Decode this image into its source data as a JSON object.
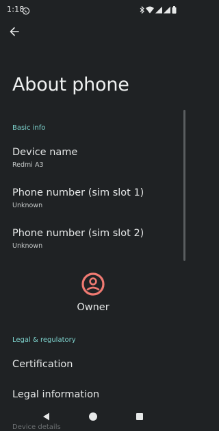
{
  "status_bar": {
    "time": "1:18",
    "notification_icon": "whatsapp-icon",
    "icons": [
      "bluetooth-icon",
      "wifi-icon",
      "signal-icon",
      "signal-icon",
      "battery-icon"
    ]
  },
  "header": {
    "back_icon": "arrow-left-icon",
    "title": "About phone"
  },
  "sections": {
    "basic_info": {
      "header": "Basic info",
      "items": [
        {
          "title": "Device name",
          "summary": "Redmi A3"
        },
        {
          "title": "Phone number (sim slot 1)",
          "summary": "Unknown"
        },
        {
          "title": "Phone number (sim slot 2)",
          "summary": "Unknown"
        }
      ]
    },
    "owner": {
      "icon": "account-circle-icon",
      "label": "Owner"
    },
    "legal": {
      "header": "Legal & regulatory",
      "items": [
        {
          "title": "Certification"
        },
        {
          "title": "Legal information"
        }
      ]
    },
    "device_details": {
      "header": "Device details"
    }
  },
  "nav_bar": {
    "back": "triangle-back-icon",
    "home": "circle-home-icon",
    "recents": "square-recents-icon"
  },
  "colors": {
    "background": "#1f2224",
    "accent": "#7fd6d0",
    "owner_avatar": "#f07a72"
  }
}
